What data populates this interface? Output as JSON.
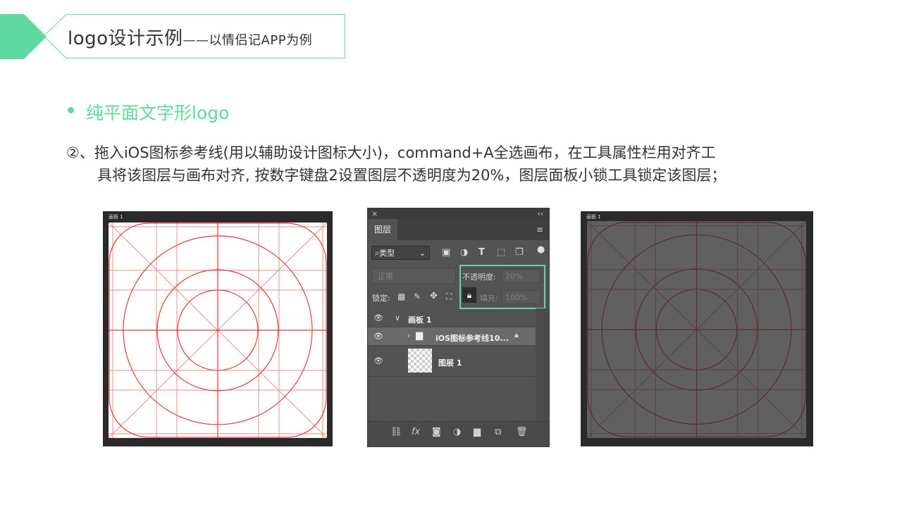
{
  "header": {
    "title_main": "logo设计示例",
    "title_dash": "——",
    "title_sub": "以情侣记APP为例",
    "accent_color": "#5fd9a0"
  },
  "section": {
    "bullet_title": "纯平面文字形logo",
    "line1": "②、拖入iOS图标参考线(用以辅助设计图标大小)，command+A全选画布，在工具属性栏用对齐工",
    "line2": "具将该图层与画布对齐, 按数字键盘2设置图层不透明度为20%，图层面板小锁工具锁定该图层；"
  },
  "artboard_left": {
    "label": "画板 1",
    "guide_color": "#e53935"
  },
  "artboard_right": {
    "label": "画板 1",
    "guide_color": "#e53935",
    "opacity_percent": 20
  },
  "layers_panel": {
    "close_icon": "×",
    "collapse_icon": "‹‹",
    "tab": "图层",
    "menu_icon": "≡",
    "filter_kind": "类型",
    "blend_mode": "正常",
    "opacity_label": "不透明度:",
    "opacity_value": "20%",
    "lock_label": "锁定:",
    "fill_label": "填充:",
    "fill_value": "100%",
    "layers": [
      {
        "name": "画板 1",
        "type": "artboard",
        "expand": "∨"
      },
      {
        "name": "iOS图标参考线10...",
        "type": "group",
        "expand": "›",
        "locked": true
      },
      {
        "name": "图层 1",
        "type": "pixel"
      }
    ],
    "fx_label": "fx"
  }
}
